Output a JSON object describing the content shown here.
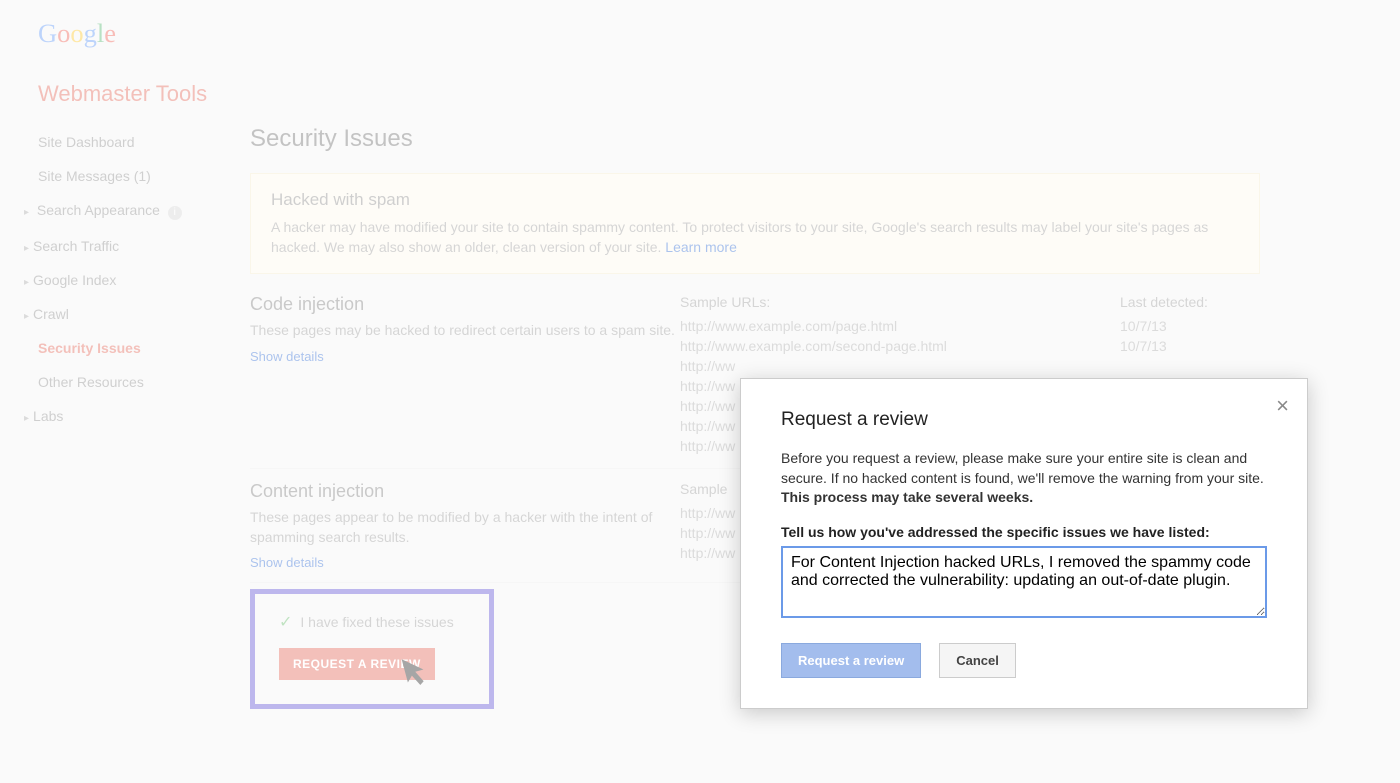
{
  "header": {
    "product": "Webmaster Tools"
  },
  "sidebar": {
    "items": [
      {
        "label": "Site Dashboard",
        "arrow": false
      },
      {
        "label": "Site Messages (1)",
        "arrow": false
      },
      {
        "label": "Search Appearance",
        "arrow": true,
        "info": true
      },
      {
        "label": "Search Traffic",
        "arrow": true
      },
      {
        "label": "Google Index",
        "arrow": true
      },
      {
        "label": "Crawl",
        "arrow": true
      },
      {
        "label": "Security Issues",
        "arrow": false,
        "active": true
      },
      {
        "label": "Other Resources",
        "arrow": false
      },
      {
        "label": "Labs",
        "arrow": true
      }
    ]
  },
  "page": {
    "title": "Security Issues"
  },
  "warning": {
    "title": "Hacked with spam",
    "text": "A hacker may have modified your site to contain spammy content. To protect visitors to your site, Google's search results may label your site's pages as hacked. We may also show an older, clean version of your site. ",
    "learn_more": "Learn more"
  },
  "columns": {
    "sample": "Sample URLs:",
    "detected": "Last detected:"
  },
  "section1": {
    "title": "Code injection",
    "desc": "These pages may be hacked to redirect certain users to a spam site.",
    "show": "Show details",
    "urls": [
      "http://www.example.com/page.html",
      "http://www.example.com/second-page.html",
      "http://ww",
      "http://ww",
      "http://ww",
      "http://ww",
      "http://ww"
    ],
    "dates": [
      "10/7/13",
      "10/7/13"
    ]
  },
  "section2": {
    "title": "Content injection",
    "desc": "These pages appear to be modified by a hacker with the intent of spamming search results.",
    "show": "Show details",
    "sample_header": "Sample",
    "urls": [
      "http://ww",
      "http://ww",
      "http://ww"
    ]
  },
  "review_box": {
    "checkbox_label": "I have fixed these issues",
    "button": "REQUEST A REVIEW"
  },
  "modal": {
    "title": "Request a review",
    "text_plain": "Before you request a review, please make sure your entire site is clean and secure. If no hacked content is found, we'll remove the warning from your site. ",
    "text_bold": "This process may take several weeks.",
    "label": "Tell us how you've addressed the specific issues we have listed:",
    "textarea_value": "For Content Injection hacked URLs, I removed the spammy code and corrected the vulnerability: updating an out-of-date plugin.",
    "submit": "Request a review",
    "cancel": "Cancel"
  }
}
